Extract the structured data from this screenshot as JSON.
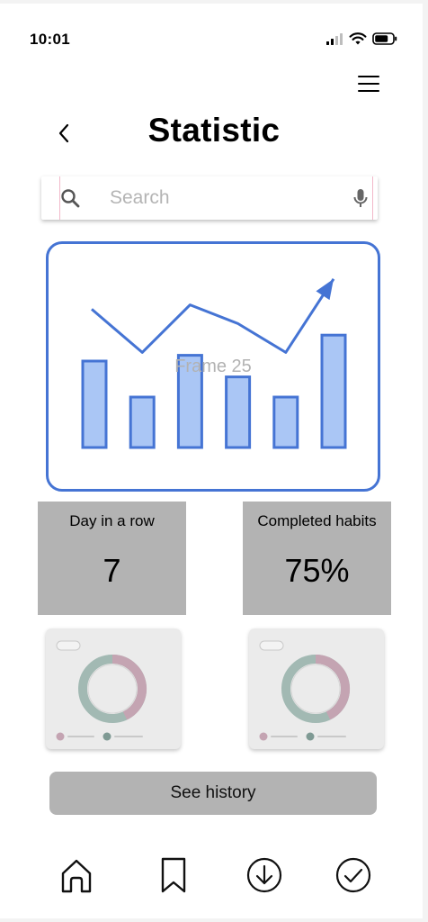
{
  "status_bar": {
    "time": "10:01",
    "icons": [
      "signal-icon",
      "wifi-icon",
      "battery-icon"
    ]
  },
  "header": {
    "title": "Statistic",
    "back_icon": "chevron-left-icon",
    "menu_icon": "hamburger-menu-icon"
  },
  "search": {
    "placeholder": "Search",
    "value": "",
    "leading_icon": "search-icon",
    "trailing_icon": "microphone-icon"
  },
  "chart_frame": {
    "label": "Frame 25",
    "accent_color": "#4574d4",
    "bar_fill": "#aac6f5"
  },
  "chart_data": {
    "type": "bar",
    "categories": [
      "",
      "",
      "",
      "",
      "",
      ""
    ],
    "values": [
      6,
      3.5,
      6.4,
      4.9,
      3.5,
      7.8
    ],
    "trend_line": [
      9.6,
      6.6,
      9.9,
      8.6,
      6.6,
      11.7
    ],
    "title": "",
    "xlabel": "",
    "ylabel": "",
    "ylim": [
      0,
      12
    ],
    "grid": false
  },
  "stats": [
    {
      "label": "Day in a row",
      "value": "7"
    },
    {
      "label": "Completed habits",
      "value": "75%"
    }
  ],
  "donut_cards": [
    {
      "colors": [
        "#c4a4b2",
        "#a2b9b3"
      ]
    },
    {
      "colors": [
        "#c4a4b2",
        "#a2b9b3"
      ]
    }
  ],
  "history_button": {
    "label": "See history"
  },
  "bottom_nav": [
    {
      "icon": "home-icon"
    },
    {
      "icon": "bookmark-icon"
    },
    {
      "icon": "download-circle-icon"
    },
    {
      "icon": "check-circle-icon"
    }
  ]
}
